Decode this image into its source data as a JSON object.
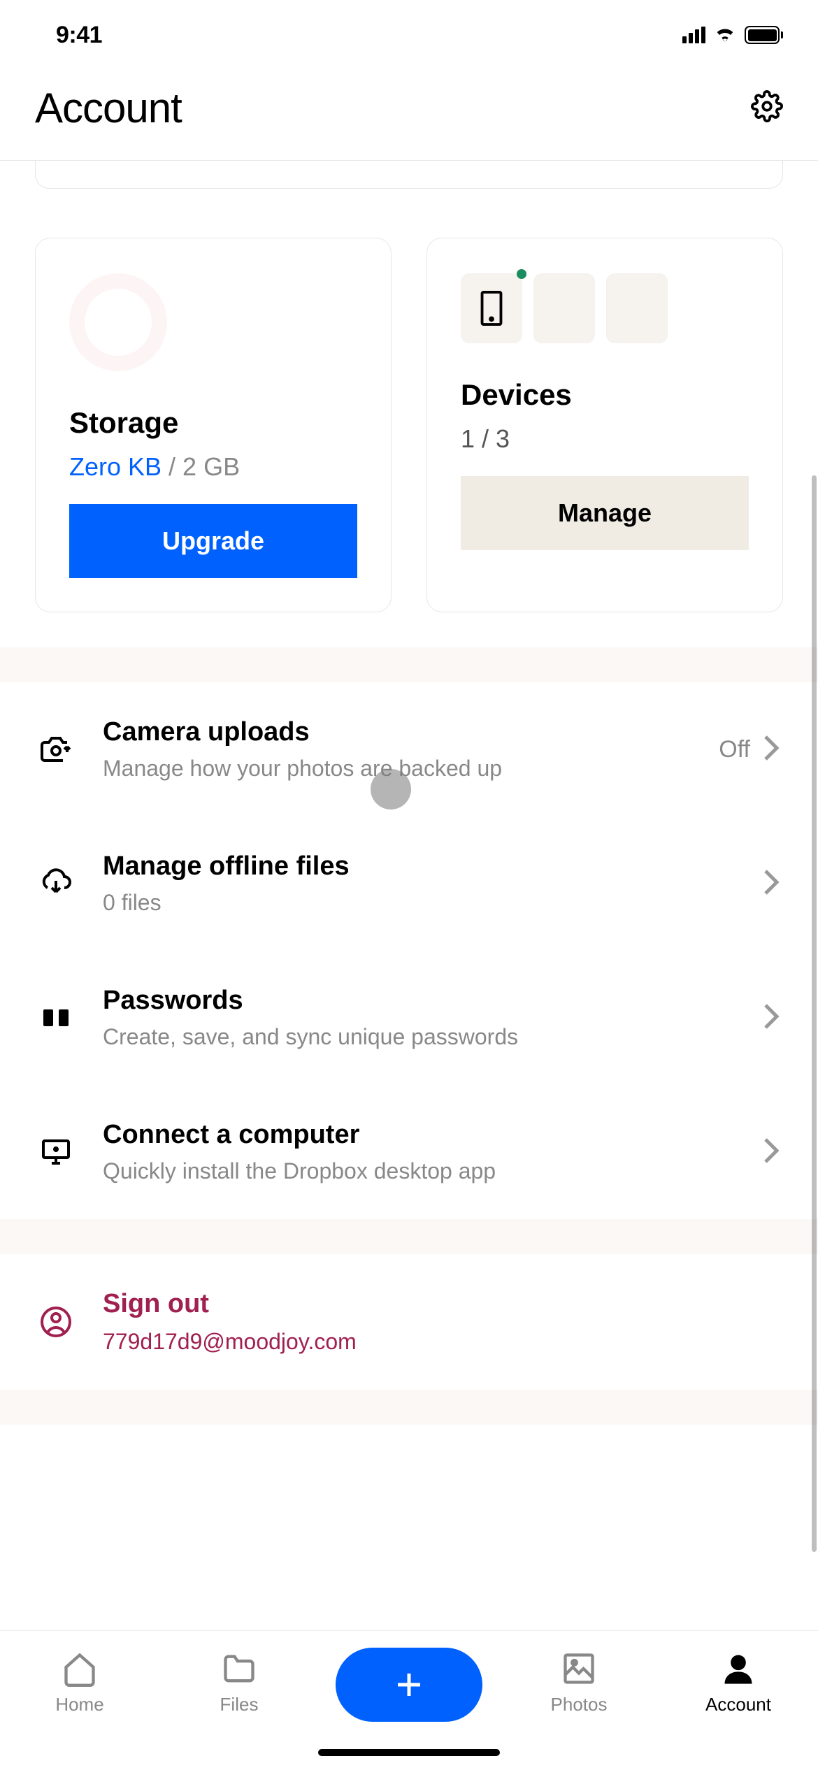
{
  "status_bar": {
    "time": "9:41"
  },
  "header": {
    "title": "Account"
  },
  "cards": {
    "storage": {
      "title": "Storage",
      "used": "Zero KB",
      "total": " / 2 GB",
      "button": "Upgrade"
    },
    "devices": {
      "title": "Devices",
      "count": "1 / 3",
      "button": "Manage"
    }
  },
  "list": {
    "camera": {
      "title": "Camera uploads",
      "subtitle": "Manage how your photos are backed up",
      "status": "Off"
    },
    "offline": {
      "title": "Manage offline files",
      "subtitle": "0 files"
    },
    "passwords": {
      "title": "Passwords",
      "subtitle": "Create, save, and sync unique passwords"
    },
    "computer": {
      "title": "Connect a computer",
      "subtitle": "Quickly install the Dropbox desktop app"
    },
    "signout": {
      "title": "Sign out",
      "email": "779d17d9@moodjoy.com"
    }
  },
  "tabs": {
    "home": "Home",
    "files": "Files",
    "photos": "Photos",
    "account": "Account"
  }
}
